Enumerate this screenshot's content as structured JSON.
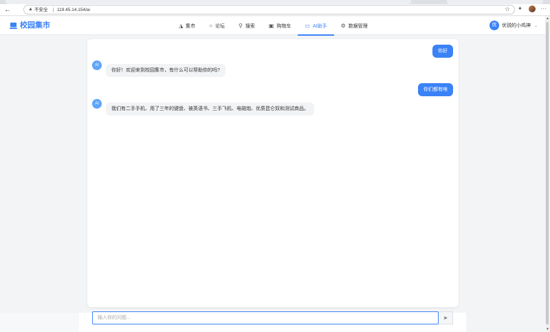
{
  "browser": {
    "back_icon": "arrow-left-icon",
    "insecure_label": "不安全",
    "url": "119.45.14.154/ai"
  },
  "app": {
    "logo_text": "校园集市",
    "accent_color": "#3b82f6"
  },
  "nav": {
    "items": [
      {
        "label": "集市",
        "icon": "bag-icon"
      },
      {
        "label": "论坛",
        "icon": "chat-icon"
      },
      {
        "label": "搜索",
        "icon": "search-icon"
      },
      {
        "label": "购物车",
        "icon": "cart-icon"
      },
      {
        "label": "AI助手",
        "icon": "monitor-icon",
        "active": true
      },
      {
        "label": "数据管理",
        "icon": "gear-icon"
      }
    ]
  },
  "user": {
    "avatar_text": "优",
    "name": "优锐的小鸡神"
  },
  "chat": {
    "messages": [
      {
        "role": "user",
        "text": "你好"
      },
      {
        "role": "ai",
        "avatar": "AI",
        "text": "你好！欢迎来到校园集市，有什么可以帮助你的吗?"
      },
      {
        "role": "user",
        "text": "你们都有啥"
      },
      {
        "role": "ai",
        "avatar": "AI",
        "text": "我们有二手手机、用了三年的键盘、被英语书、三手飞机、电磁炮、优质昆仑奴和测试商品。"
      }
    ],
    "input_placeholder": "输入你的问题...",
    "send_icon": "send-icon"
  }
}
